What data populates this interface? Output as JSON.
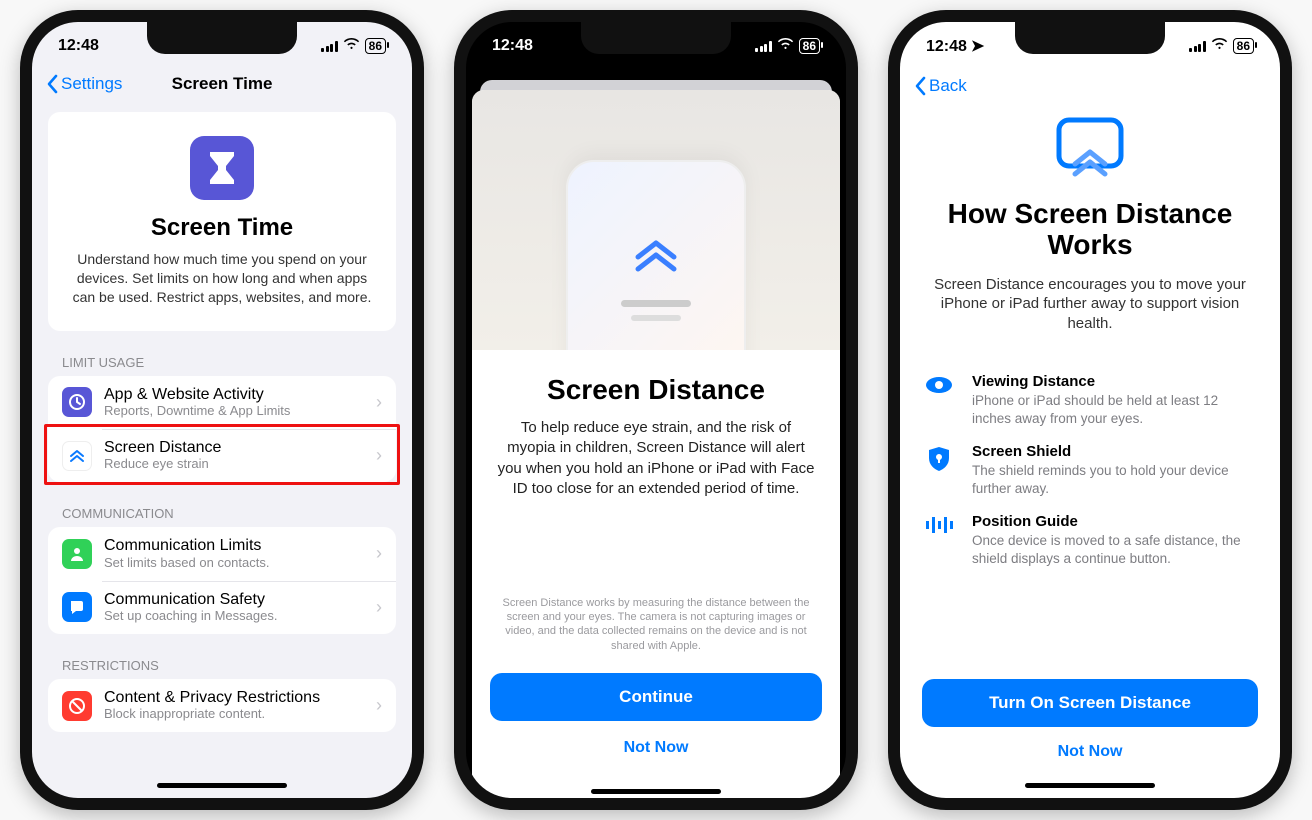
{
  "status": {
    "time": "12:48",
    "battery": "86"
  },
  "phone1": {
    "back": "Settings",
    "title": "Screen Time",
    "hero_title": "Screen Time",
    "hero_text": "Understand how much time you spend on your devices. Set limits on how long and when apps can be used. Restrict apps, websites, and more.",
    "section_limit": "LIMIT USAGE",
    "item_app_title": "App & Website Activity",
    "item_app_sub": "Reports, Downtime & App Limits",
    "item_dist_title": "Screen Distance",
    "item_dist_sub": "Reduce eye strain",
    "section_comm": "COMMUNICATION",
    "item_cl_title": "Communication Limits",
    "item_cl_sub": "Set limits based on contacts.",
    "item_cs_title": "Communication Safety",
    "item_cs_sub": "Set up coaching in Messages.",
    "section_restr": "RESTRICTIONS",
    "item_cp_title": "Content & Privacy Restrictions",
    "item_cp_sub": "Block inappropriate content."
  },
  "phone2": {
    "title": "Screen Distance",
    "text": "To help reduce eye strain, and the risk of myopia in children, Screen Distance will alert you when you hold an iPhone or iPad with Face ID too close for an extended period of time.",
    "fineprint": "Screen Distance works by measuring the distance between the screen and your eyes. The camera is not capturing images or video, and the data collected remains on the device and is not shared with Apple.",
    "btn_continue": "Continue",
    "btn_notnow": "Not Now"
  },
  "phone3": {
    "back": "Back",
    "title": "How Screen Distance Works",
    "text": "Screen Distance encourages you to move your iPhone or iPad further away to support vision health.",
    "feat1_title": "Viewing Distance",
    "feat1_text": "iPhone or iPad should be held at least 12 inches away from your eyes.",
    "feat2_title": "Screen Shield",
    "feat2_text": "The shield reminds you to hold your device further away.",
    "feat3_title": "Position Guide",
    "feat3_text": "Once device is moved to a safe distance, the shield displays a continue button.",
    "btn_turnon": "Turn On Screen Distance",
    "btn_notnow": "Not Now"
  }
}
